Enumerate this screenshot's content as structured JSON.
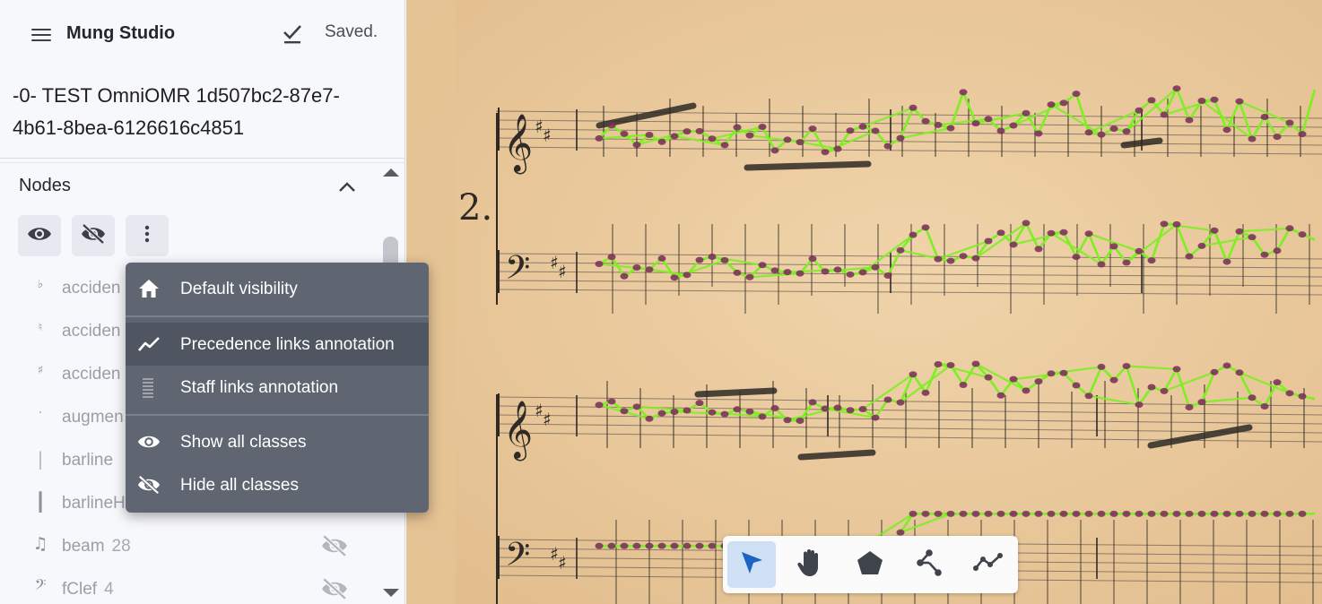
{
  "app": {
    "title": "Mung Studio",
    "save_status": "Saved."
  },
  "document": {
    "title": "-0- TEST OmniOMR 1d507bc2-87e7-4b61-8bea-6126616c4851"
  },
  "nodes_panel": {
    "header": "Nodes",
    "classes": [
      {
        "glyph": "♭",
        "name": "acciden",
        "count": "",
        "icon": "flat-icon"
      },
      {
        "glyph": "♮",
        "name": "acciden",
        "count": "",
        "icon": "natural-icon"
      },
      {
        "glyph": "♯",
        "name": "acciden",
        "count": "",
        "icon": "sharp-icon"
      },
      {
        "glyph": "·",
        "name": "augmen",
        "count": "",
        "icon": "dot-icon"
      },
      {
        "glyph": "|",
        "name": "barline",
        "count": "",
        "icon": "barline-icon"
      },
      {
        "glyph": "┃",
        "name": "barlineH",
        "count": "",
        "icon": "heavy-barline-icon"
      },
      {
        "glyph": "♫",
        "name": "beam",
        "count": "28",
        "icon": "beam-icon"
      },
      {
        "glyph": "𝄢",
        "name": "fClef",
        "count": "4",
        "icon": "fclef-icon"
      }
    ]
  },
  "dropdown_menu": {
    "items": [
      {
        "label": "Default visibility",
        "icon": "home-icon"
      },
      {
        "label": "Precedence links annotation",
        "icon": "trend-line-icon",
        "active": true
      },
      {
        "label": "Staff links annotation",
        "icon": "staff-lines-icon"
      },
      {
        "label": "Show all classes",
        "icon": "eye-icon"
      },
      {
        "label": "Hide all classes",
        "icon": "eye-off-icon"
      }
    ]
  },
  "toolbar": {
    "tools": [
      {
        "name": "pointer-tool",
        "icon": "cursor-arrow-icon",
        "active": true
      },
      {
        "name": "hand-tool",
        "icon": "hand-icon"
      },
      {
        "name": "polygon-tool",
        "icon": "pentagon-icon"
      },
      {
        "name": "node-link-tool",
        "icon": "graph-links-icon"
      },
      {
        "name": "precedence-tool",
        "icon": "trend-line-icon"
      }
    ]
  },
  "colors": {
    "sidebar_bg": "#f7f8fb",
    "menu_bg": "#5f6672",
    "paper": "#e9c79b",
    "link_green": "#7cf021",
    "notehead_purple": "#7a2a5a",
    "tool_active": "#cfe0f5"
  }
}
